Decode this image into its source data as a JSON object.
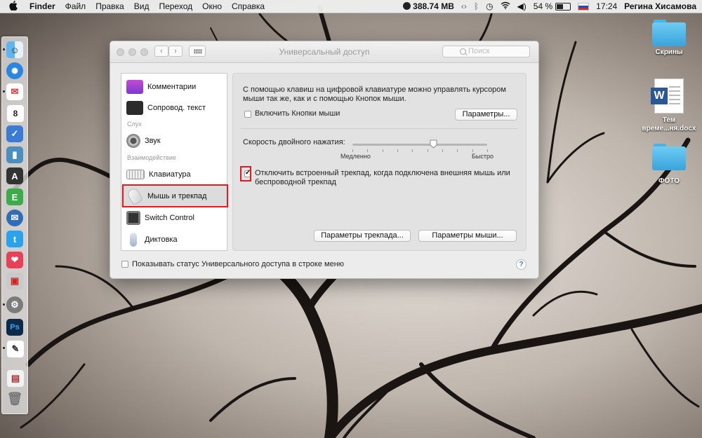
{
  "menubar": {
    "items": [
      "Finder",
      "Файл",
      "Правка",
      "Вид",
      "Переход",
      "Окно",
      "Справка"
    ],
    "memory": "388.74 MB",
    "battery": "54 %",
    "time": "17:24",
    "user": "Регина Хисамова"
  },
  "desktop": {
    "icons": [
      {
        "label": "Скрины",
        "type": "folder"
      },
      {
        "label": "Тем време...ня.docx",
        "type": "word-document"
      },
      {
        "label": "ФОТО",
        "type": "folder"
      }
    ],
    "folder_color": "#3aa3dc"
  },
  "dock": {
    "apps": [
      "finder-icon",
      "safari-icon",
      "mail-icon",
      "calendar-icon",
      "reminders-icon",
      "dictionary-icon",
      "font-book-icon",
      "evernote-icon",
      "thunderbird-icon",
      "twitter-icon",
      "pocket-icon",
      "preview-icon",
      "system-preferences-icon",
      "photoshop-icon",
      "textedit-icon",
      "pages-icon",
      "trash-icon"
    ]
  },
  "window": {
    "title": "Универсальный доступ",
    "search_placeholder": "Поиск",
    "sidebar": {
      "items": [
        {
          "label": "Комментарии",
          "icon": "comments-icon"
        },
        {
          "label": "Сопровод. текст",
          "icon": "captions-icon"
        },
        {
          "label": "Звук",
          "icon": "speaker-icon"
        },
        {
          "label": "Клавиатура",
          "icon": "keyboard-icon"
        },
        {
          "label": "Мышь и трекпад",
          "icon": "mouse-icon"
        },
        {
          "label": "Switch Control",
          "icon": "switch-control-icon"
        },
        {
          "label": "Диктовка",
          "icon": "microphone-icon"
        }
      ],
      "groups": [
        "Слух",
        "Взаимодействие"
      ],
      "selected": "Мышь и трекпад"
    },
    "pane": {
      "description": "С помощью клавиш на цифровой клавиатуре можно управлять курсором мыши так же, как и с помощью Кнопок мыши.",
      "mouse_keys_label": "Включить Кнопки мыши",
      "mouse_keys_checked": false,
      "options_button": "Параметры...",
      "double_click_label": "Скорость двойного нажатия:",
      "slider_min_label": "Медленно",
      "slider_max_label": "Быстро",
      "slider_value": 0.6,
      "ignore_trackpad_label": "Отключить встроенный трекпад, когда подключена внешняя мышь или беспроводной трекпад",
      "ignore_trackpad_checked": true,
      "trackpad_options_button": "Параметры трекпада...",
      "mouse_options_button": "Параметры мыши..."
    },
    "status_menu_label": "Показывать статус Универсального доступа в строке меню",
    "status_menu_checked": false,
    "help_symbol": "?",
    "highlight_color": "#e01b22"
  }
}
